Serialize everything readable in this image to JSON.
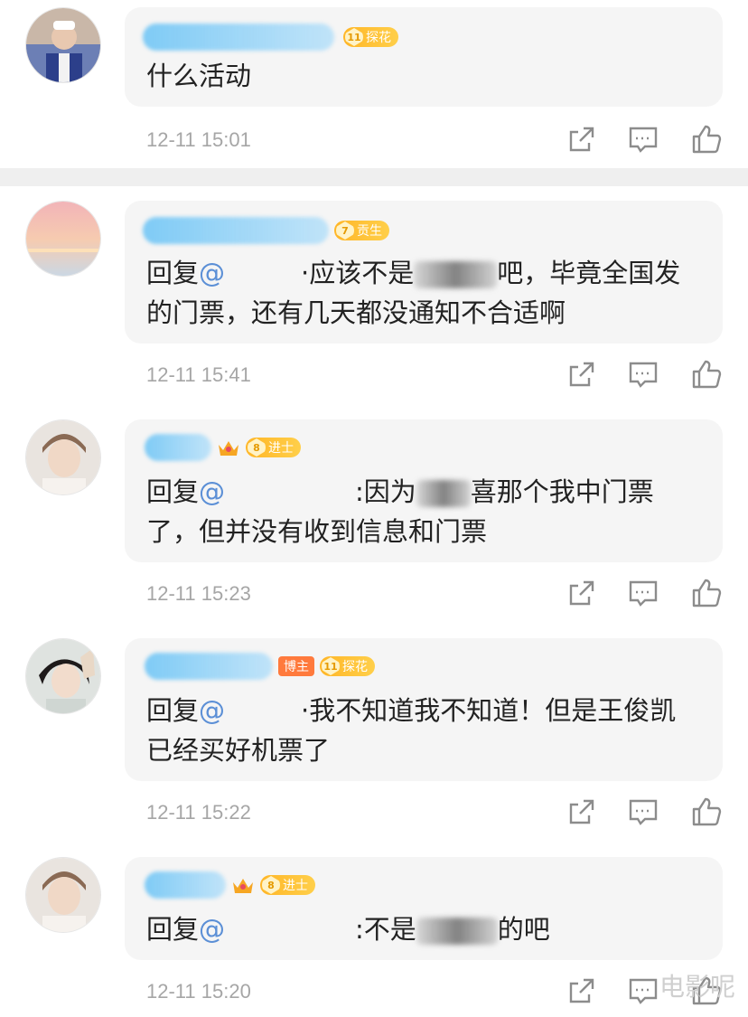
{
  "comments": [
    {
      "badge_level": "11",
      "badge_label": "探花",
      "text": "什么活动",
      "time": "12-11 15:01"
    },
    {
      "badge_level": "7",
      "badge_label": "贡生",
      "reply": "回复",
      "mention": "@",
      "text_a": "·应该不是",
      "text_b": "吧，毕竟全国发",
      "text_c": "的门票，还有几天都没通知不合适啊",
      "time": "12-11 15:41"
    },
    {
      "badge_level": "8",
      "badge_label": "进士",
      "reply": "回复",
      "mention": "@",
      "text_a": ":因为",
      "text_b": "喜那个我中门票",
      "text_c": "了，但并没有收到信息和门票",
      "time": "12-11 15:23"
    },
    {
      "blogger_label": "博主",
      "badge_level": "11",
      "badge_label": "探花",
      "reply": "回复",
      "mention": "@",
      "text_a": "·我不知道我不知道！但是王俊凯",
      "text_c": "已经买好机票了",
      "time": "12-11 15:22"
    },
    {
      "badge_level": "8",
      "badge_label": "进士",
      "reply": "回复",
      "mention": "@",
      "text_a": ":不是",
      "text_b": "的吧",
      "time": "12-11 15:20"
    }
  ],
  "actions": {
    "share_icon": "share-icon",
    "comment_icon": "comment-icon",
    "like_icon": "like-icon"
  },
  "watermark": "电影呢"
}
